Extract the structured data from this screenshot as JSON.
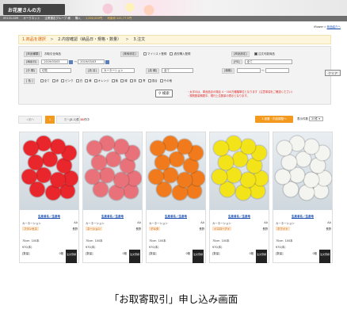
{
  "brand": {
    "logo": "お花屋さんの方"
  },
  "infobar": {
    "id": "05131-009",
    "name": "オークネット",
    "group": "企業選定グループ 様",
    "credit_label": "購入",
    "credit_value": "1,000,000円",
    "available_label": "利用枠 241,77 5円"
  },
  "toplinks": {
    "user": "iflower",
    "sep": "»",
    "link": "商品紹介へ"
  },
  "steps": {
    "s1": "1.商品を選択",
    "s2": "2.内容確認（納品日・規格・数量）",
    "s3": "3.注文",
    "arrow": ">"
  },
  "filter": {
    "label_category": "[商品種類]",
    "value_category": "お取引全商品",
    "label_search": "[検索設定]",
    "chk_mylist": "マイリスト登録",
    "chk_fav": "過去購入登録",
    "label_product": "[商品設定]",
    "chk_available": "注文可能商品",
    "label_period": "[納品日]",
    "date_from": "2019/03/03",
    "date_to": "2019/03/03",
    "date_sep": "〜",
    "label_pd": "[PD]",
    "pd_value": "全て",
    "label_class": "[分 類]",
    "class_value": "切花",
    "label_item": "[品 目]",
    "item_value": "カーネーション",
    "label_kind": "[品 種]",
    "kind_value": "全て",
    "label_price": "[価格]",
    "price_sep": "〜",
    "clear": "クリア",
    "label_color": "[ 色 ]",
    "colors": [
      "全て",
      "赤",
      "ピンク",
      "白",
      "黄",
      "オレンジ",
      "紫",
      "緑",
      "茶",
      "青",
      "混合",
      "その他"
    ],
    "search": "検索",
    "note1": "・太字のは、単品品目の場合 4 ~100万種類単位となります（注意事項をご確認ください）",
    "note2": "・規則数量期間中、現行上位数量の表示となります。"
  },
  "pager": {
    "prev": "＜前へ",
    "current": "1",
    "next": "次へ＞",
    "hits_prefix": "[1-1]件 ",
    "hits_count": "11",
    "hits_suffix": "件中",
    "orange_btn": "1 設置・内容調整へ",
    "perpage_label": "表示件数",
    "perpage_value": "20件 ▾"
  },
  "products": [
    {
      "name": "生産者名／生産地",
      "item": "カーネーション",
      "grade": "AA",
      "variety": "フランセス",
      "origin": "長野",
      "length": "70cm",
      "pieces": "100本",
      "price": "¥70(本)",
      "stock_label": "[数量]",
      "stock": "0箱",
      "buy": "注文登録"
    },
    {
      "name": "生産者名／生産地",
      "item": "カーネーション",
      "grade": "AA",
      "variety": "ネーション",
      "origin": "長野",
      "length": "70cm",
      "pieces": "100本",
      "price": "¥70(本)",
      "stock_label": "[数量]",
      "stock": "0箱",
      "buy": "注文登録"
    },
    {
      "name": "生産者名／生産地",
      "item": "カーネーション",
      "grade": "AA",
      "variety": "デルタ",
      "origin": "長野",
      "length": "70cm",
      "pieces": "100本",
      "price": "¥70(本)",
      "stock_label": "[数量]",
      "stock": "0箱",
      "buy": "注文登録"
    },
    {
      "name": "生産者名／生産地",
      "item": "カーネーション",
      "grade": "AA",
      "variety": "イエローアイ",
      "origin": "長野",
      "length": "70cm",
      "pieces": "100本",
      "price": "¥70(本)",
      "stock_label": "[数量]",
      "stock": "0箱",
      "buy": "注文登録"
    },
    {
      "name": "生産者名／生産地",
      "item": "カーネーション",
      "grade": "AA",
      "variety": "ホワイト",
      "origin": "長野",
      "length": "70cm",
      "pieces": "100本",
      "price": "¥70(本)",
      "stock_label": "[数量]",
      "stock": "0箱",
      "buy": "注文登録"
    }
  ],
  "flower_colors": [
    "#e8262c",
    "#e9727a",
    "#f07a1c",
    "#f3e41a",
    "#f4f4f0"
  ],
  "caption": "「お取寄取引」申し込み画面"
}
